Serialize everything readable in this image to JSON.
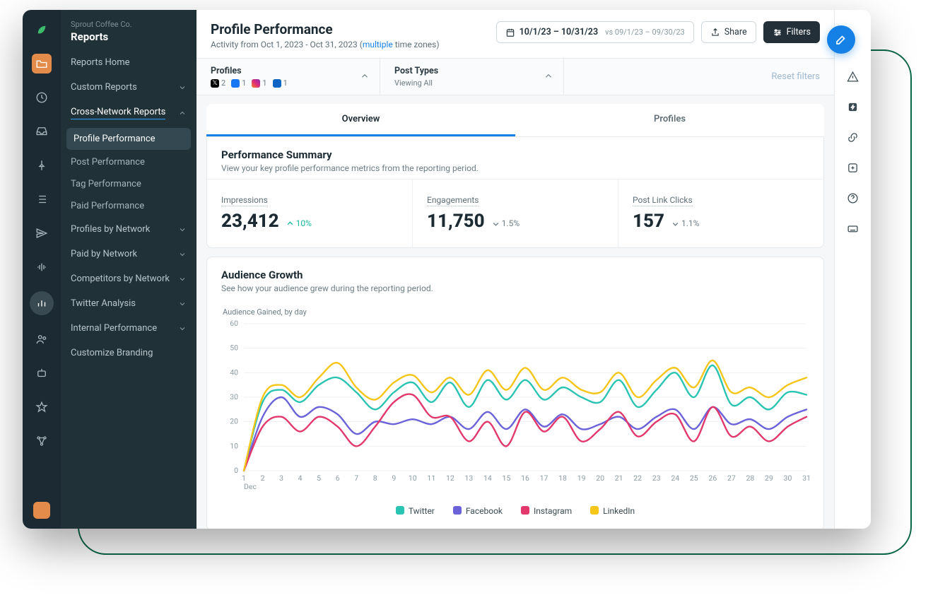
{
  "org": "Sprout Coffee Co.",
  "section": "Reports",
  "sidenav": {
    "reports_home": "Reports Home",
    "custom_reports": "Custom Reports",
    "cross_network": "Cross-Network Reports",
    "sub": {
      "profile_performance": "Profile Performance",
      "post_performance": "Post Performance",
      "tag_performance": "Tag Performance",
      "paid_performance": "Paid Performance"
    },
    "profiles_by_network": "Profiles by Network",
    "paid_by_network": "Paid by Network",
    "competitors_by_network": "Competitors by Network",
    "twitter_analysis": "Twitter Analysis",
    "internal_performance": "Internal Performance",
    "customize_branding": "Customize Branding"
  },
  "header": {
    "title": "Profile Performance",
    "activity_prefix": "Activity from Oct 1, 2023 - Oct 31, 2023 (",
    "activity_link": "multiple",
    "activity_suffix": " time zones)",
    "date_main": "10/1/23 – 10/31/23",
    "date_compare": "vs 09/1/23 – 09/30/23",
    "share": "Share",
    "filters": "Filters"
  },
  "filterbar": {
    "profiles_label": "Profiles",
    "post_types_label": "Post Types",
    "post_types_sub": "Viewing All",
    "reset": "Reset filters",
    "counts": {
      "x": "2",
      "fb": "1",
      "ig": "1",
      "li": "1"
    }
  },
  "tabs": {
    "overview": "Overview",
    "profiles": "Profiles"
  },
  "summary": {
    "title": "Performance Summary",
    "sub": "View your key profile performance metrics from the reporting period.",
    "metrics": [
      {
        "label": "Impressions",
        "value": "23,412",
        "delta": "10%",
        "dir": "up"
      },
      {
        "label": "Engagements",
        "value": "11,750",
        "delta": "1.5%",
        "dir": "down"
      },
      {
        "label": "Post Link Clicks",
        "value": "157",
        "delta": "1.1%",
        "dir": "down"
      }
    ]
  },
  "growth": {
    "title": "Audience Growth",
    "sub": "See how your audience grew during the reporting period.",
    "chart_label": "Audience Gained, by day",
    "month": "Dec",
    "legend": {
      "twitter": "Twitter",
      "facebook": "Facebook",
      "instagram": "Instagram",
      "linkedin": "LinkedIn"
    }
  },
  "colors": {
    "twitter": "#2ac4b3",
    "facebook": "#6b62d9",
    "instagram": "#e3386b",
    "linkedin": "#f5c518"
  },
  "chart_data": {
    "type": "line",
    "title": "Audience Gained, by day",
    "xlabel": "Dec",
    "ylabel": "",
    "ylim": [
      0,
      60
    ],
    "yticks": [
      0,
      10,
      20,
      30,
      40,
      50,
      60
    ],
    "categories": [
      1,
      2,
      3,
      4,
      5,
      6,
      7,
      8,
      9,
      10,
      11,
      12,
      13,
      14,
      15,
      16,
      17,
      18,
      19,
      20,
      21,
      22,
      23,
      24,
      25,
      26,
      27,
      28,
      29,
      30,
      31
    ],
    "series": [
      {
        "name": "Twitter",
        "color": "#2ac4b3",
        "values": [
          0,
          28,
          33,
          28,
          35,
          38,
          32,
          25,
          32,
          36,
          28,
          36,
          26,
          37,
          29,
          37,
          29,
          34,
          30,
          28,
          37,
          26,
          33,
          40,
          30,
          43,
          27,
          30,
          25,
          32,
          31
        ]
      },
      {
        "name": "Facebook",
        "color": "#6b62d9",
        "values": [
          0,
          22,
          30,
          22,
          26,
          23,
          15,
          20,
          19,
          21,
          19,
          22,
          17,
          24,
          17,
          25,
          18,
          23,
          17,
          19,
          22,
          17,
          22,
          25,
          17,
          26,
          19,
          21,
          17,
          22,
          25
        ]
      },
      {
        "name": "Instagram",
        "color": "#e3386b",
        "values": [
          0,
          18,
          22,
          16,
          22,
          18,
          10,
          18,
          28,
          31,
          22,
          22,
          12,
          20,
          10,
          24,
          16,
          22,
          12,
          17,
          24,
          14,
          20,
          23,
          12,
          26,
          14,
          18,
          12,
          18,
          22
        ]
      },
      {
        "name": "LinkedIn",
        "color": "#f5c518",
        "values": [
          0,
          30,
          35,
          30,
          38,
          44,
          34,
          29,
          36,
          39,
          32,
          38,
          31,
          41,
          33,
          42,
          33,
          38,
          33,
          32,
          40,
          30,
          37,
          42,
          34,
          45,
          32,
          34,
          30,
          35,
          38
        ]
      }
    ]
  }
}
